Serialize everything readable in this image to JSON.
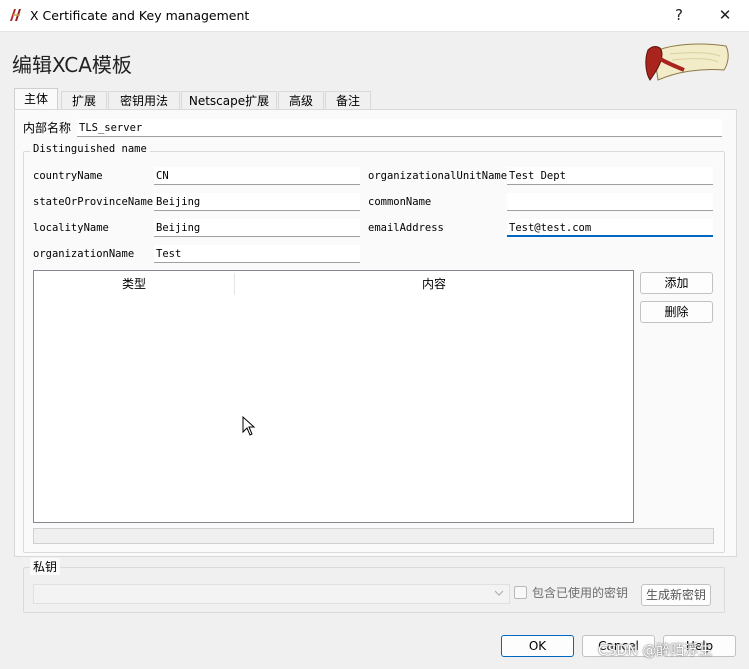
{
  "window": {
    "title": "X Certificate and Key management",
    "help_label": "?",
    "close_label": "✕"
  },
  "heading": "编辑XCA模板",
  "tabs": [
    {
      "label": "主体",
      "active": true
    },
    {
      "label": "扩展",
      "active": false
    },
    {
      "label": "密钥用法",
      "active": false
    },
    {
      "label": "Netscape扩展",
      "active": false
    },
    {
      "label": "高级",
      "active": false
    },
    {
      "label": "备注",
      "active": false
    }
  ],
  "internal_name": {
    "label": "内部名称",
    "value": "TLS_server"
  },
  "dn": {
    "title": "Distinguished name",
    "countryName": {
      "label": "countryName",
      "value": "CN"
    },
    "stateOrProvinceName": {
      "label": "stateOrProvinceName",
      "value": "Beijing"
    },
    "localityName": {
      "label": "localityName",
      "value": "Beijing"
    },
    "organizationName": {
      "label": "organizationName",
      "value": "Test"
    },
    "organizationalUnitName": {
      "label": "organizationalUnitName",
      "value": "Test Dept"
    },
    "commonName": {
      "label": "commonName",
      "value": ""
    },
    "emailAddress": {
      "label": "emailAddress",
      "value": "Test@test.com"
    }
  },
  "table": {
    "columns": [
      "类型",
      "内容"
    ],
    "rows": []
  },
  "buttons": {
    "add": "添加",
    "delete": "删除",
    "generate_key": "生成新密钥",
    "ok": "OK",
    "cancel": "Cancel",
    "help": "Help"
  },
  "private_key": {
    "title": "私钥",
    "selected": "",
    "used_keys_label": "包含已使用的密钥",
    "used_keys_checked": false
  },
  "watermark": "CSDN @醉陌浮生",
  "colors": {
    "accent": "#0067c0",
    "background": "#f0f0f0",
    "panel": "#fafafa"
  }
}
